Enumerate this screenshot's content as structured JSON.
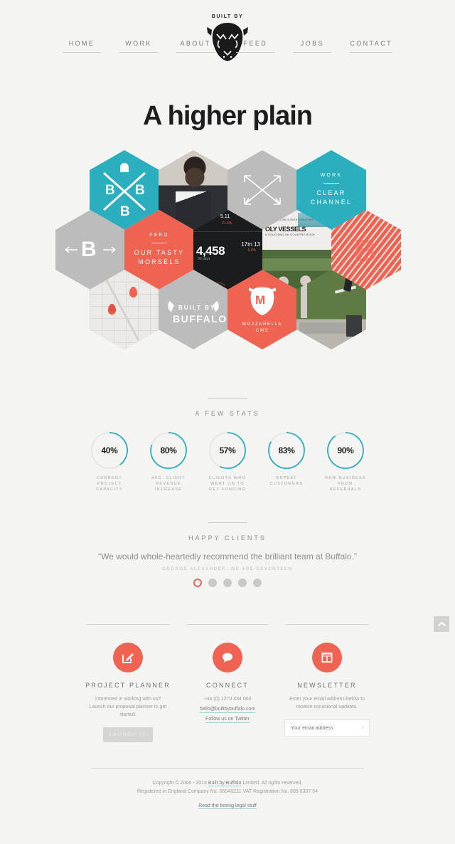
{
  "header": {
    "brand_kicker": "BUILT BY",
    "logo_icon": "buffalo-head-logo",
    "nav_left": [
      {
        "label": "HOME"
      },
      {
        "label": "WORK"
      },
      {
        "label": "ABOUT"
      }
    ],
    "nav_right": [
      {
        "label": "FEED"
      },
      {
        "label": "JOBS"
      },
      {
        "label": "CONTACT"
      }
    ]
  },
  "hero": {
    "title": "A higher plain"
  },
  "hex_grid": {
    "cells": [
      {
        "id": "bbb-logo",
        "kind": "teal",
        "top": "",
        "main": "",
        "sub": "",
        "icon": "bbb-x-logo"
      },
      {
        "id": "portrait-photo",
        "kind": "photo",
        "top": "",
        "main": "",
        "sub": "",
        "icon": "portrait-photo"
      },
      {
        "id": "arrows",
        "kind": "gray",
        "top": "",
        "main": "",
        "sub": "",
        "icon": "crossed-arrows-icon"
      },
      {
        "id": "clear-channel",
        "kind": "teal",
        "top": "WORK",
        "main": "CLEAR\nCHANNEL",
        "sub": "",
        "icon": ""
      },
      {
        "id": "b-arrows",
        "kind": "gray",
        "top": "",
        "main": "",
        "sub": "",
        "icon": "b-arrows-icon"
      },
      {
        "id": "feed",
        "kind": "coral",
        "top": "FEED",
        "main": "OUR TASTY\nMORSELS",
        "sub": "",
        "icon": ""
      },
      {
        "id": "dashboard-photo",
        "kind": "photo",
        "top": "",
        "main": "",
        "sub": "",
        "icon": "dashboard-screenshot"
      },
      {
        "id": "poster-photo",
        "kind": "photo",
        "top": "",
        "main": "",
        "sub": "",
        "icon": "poster-photo"
      },
      {
        "id": "b-stripes",
        "kind": "stripe",
        "top": "",
        "main": "",
        "sub": "",
        "icon": "b-stripes-icon"
      },
      {
        "id": "map",
        "kind": "photo",
        "top": "",
        "main": "",
        "sub": "",
        "icon": "map-photo"
      },
      {
        "id": "built-by-buffalo",
        "kind": "gray",
        "top": "BUILT BY",
        "main": "BUFFALO",
        "sub": "",
        "icon": "horns-icon"
      },
      {
        "id": "mozzarella",
        "kind": "coral",
        "top": "",
        "main": "",
        "sub": "MOZZARELLA\nCMS",
        "icon": "mozzarella-m-icon"
      },
      {
        "id": "skate-photo",
        "kind": "photo",
        "top": "",
        "main": "",
        "sub": "",
        "icon": "skate-photo"
      }
    ],
    "dashboard": {
      "big_number": "4,458",
      "big_sub": "30 days",
      "right_value": "17m 13",
      "right_delta": "6.4%",
      "top_value": "5.11",
      "top_delta": "21.4%"
    },
    "poster": {
      "kicker": "JAMES, OLSTONE & RIVER LONG EVENT LISTINGS",
      "title": "OLY VESSELS",
      "subtitle": "A TOUCHING UK COUNTRY ROCK"
    }
  },
  "stats": {
    "title": "A FEW STATS",
    "items": [
      {
        "value": "40%",
        "percent": 40,
        "caption": "CURRENT\nPROJECT\nCAPACITY"
      },
      {
        "value": "80%",
        "percent": 80,
        "caption": "AVG. CLIENT\nREVENUE\nINCREASE"
      },
      {
        "value": "57%",
        "percent": 57,
        "caption": "CLIENTS WHO\nWENT ON TO\nGET FUNDING"
      },
      {
        "value": "83%",
        "percent": 83,
        "caption": "REPEAT\nCUSTOMERS"
      },
      {
        "value": "90%",
        "percent": 90,
        "caption": "NEW BUSINESS\nFROM\nREFERRALS"
      }
    ]
  },
  "testimonial": {
    "title": "HAPPY CLIENTS",
    "quote": "“We would whole-heartedly recommend the brilliant team at Buffalo.”",
    "cite": "GEORGE ALEXANDER, WE ARE SEVENTEEN",
    "slide_count": 5,
    "active_slide": 1
  },
  "footer_columns": [
    {
      "id": "project-planner",
      "icon": "edit-pencil-icon",
      "title": "PROJECT PLANNER",
      "text": "Interested in working with us? Launch our proposal planner to get started.",
      "button_label": "LAUNCH IT"
    },
    {
      "id": "connect",
      "icon": "speech-bubble-icon",
      "title": "CONNECT",
      "text": "+44 (0) 1273 434 060",
      "email": "hello@builtbybuffalo.com",
      "twitter_label": "Follow us on Twitter"
    },
    {
      "id": "newsletter",
      "icon": "layout-grid-icon",
      "title": "NEWSLETTER",
      "text": "Enter your email address below to receive occasional updates.",
      "input_value": "",
      "input_placeholder": "Your email address",
      "submit_glyph": "›"
    }
  ],
  "copyright": {
    "line1_pre": "Copyright © 2006 - 2013 ",
    "line1_link": "Built by Buffalo",
    "line1_post": " Limited. All rights reserved.",
    "line2": "Registered in England Company No. 06048231 VAT Registration No. 899 6307 54",
    "legal_link": "Read the boring legal stuff"
  },
  "scroll_top": {
    "icon": "chevron-up-icon"
  },
  "colors": {
    "teal": "#2BAEBE",
    "coral": "#EE6352",
    "gray": "#bcbcbc",
    "background": "#f4f4f2"
  }
}
